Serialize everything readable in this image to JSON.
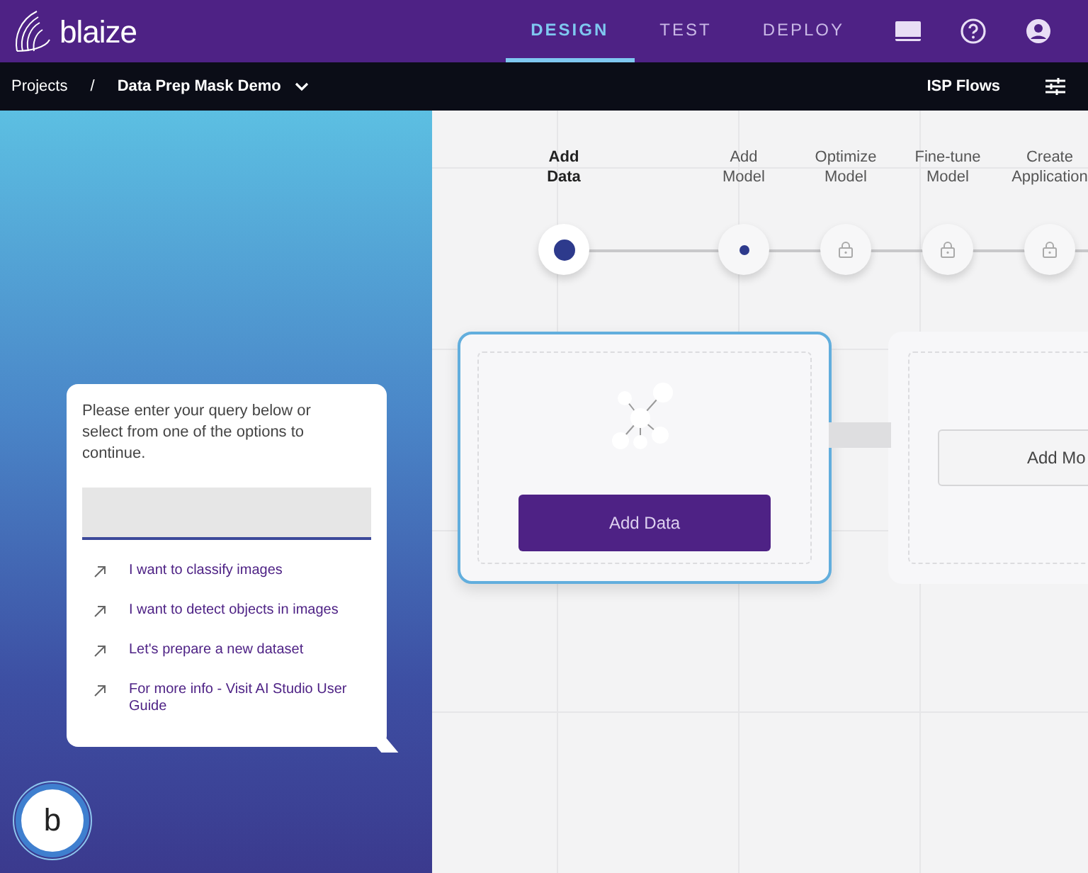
{
  "header": {
    "logo": "blaize",
    "tabs": [
      {
        "label": "DESIGN",
        "selected": true
      },
      {
        "label": "TEST",
        "selected": false
      },
      {
        "label": "DEPLOY",
        "selected": false
      }
    ]
  },
  "breadcrumb": {
    "items": [
      "Projects",
      "Data Prep Mask Demo"
    ],
    "separator": "/",
    "right_link": "ISP Flows"
  },
  "assistant": {
    "prompt": "Please enter your query below or select from one of the options to continue.",
    "options": [
      "I want to classify images",
      "I want to detect objects in images",
      "Let's prepare a new dataset",
      "For more info - Visit AI Studio User Guide"
    ],
    "bot_letter": "b"
  },
  "stepper": [
    {
      "label_lines": [
        "Add",
        "Data"
      ],
      "current": true,
      "locked": false
    },
    {
      "label_lines": [
        "Add",
        "Model"
      ],
      "current": false,
      "locked": false
    },
    {
      "label_lines": [
        "Optimize",
        "Model"
      ],
      "current": false,
      "locked": true
    },
    {
      "label_lines": [
        "Fine-tune",
        "Model"
      ],
      "current": false,
      "locked": true
    },
    {
      "label_lines": [
        "Create",
        "Application"
      ],
      "current": false,
      "locked": true
    }
  ],
  "cards": [
    {
      "kind": "data",
      "button": "Add Data",
      "selected": true
    },
    {
      "kind": "model",
      "button": "Add Mo",
      "selected": false
    }
  ]
}
